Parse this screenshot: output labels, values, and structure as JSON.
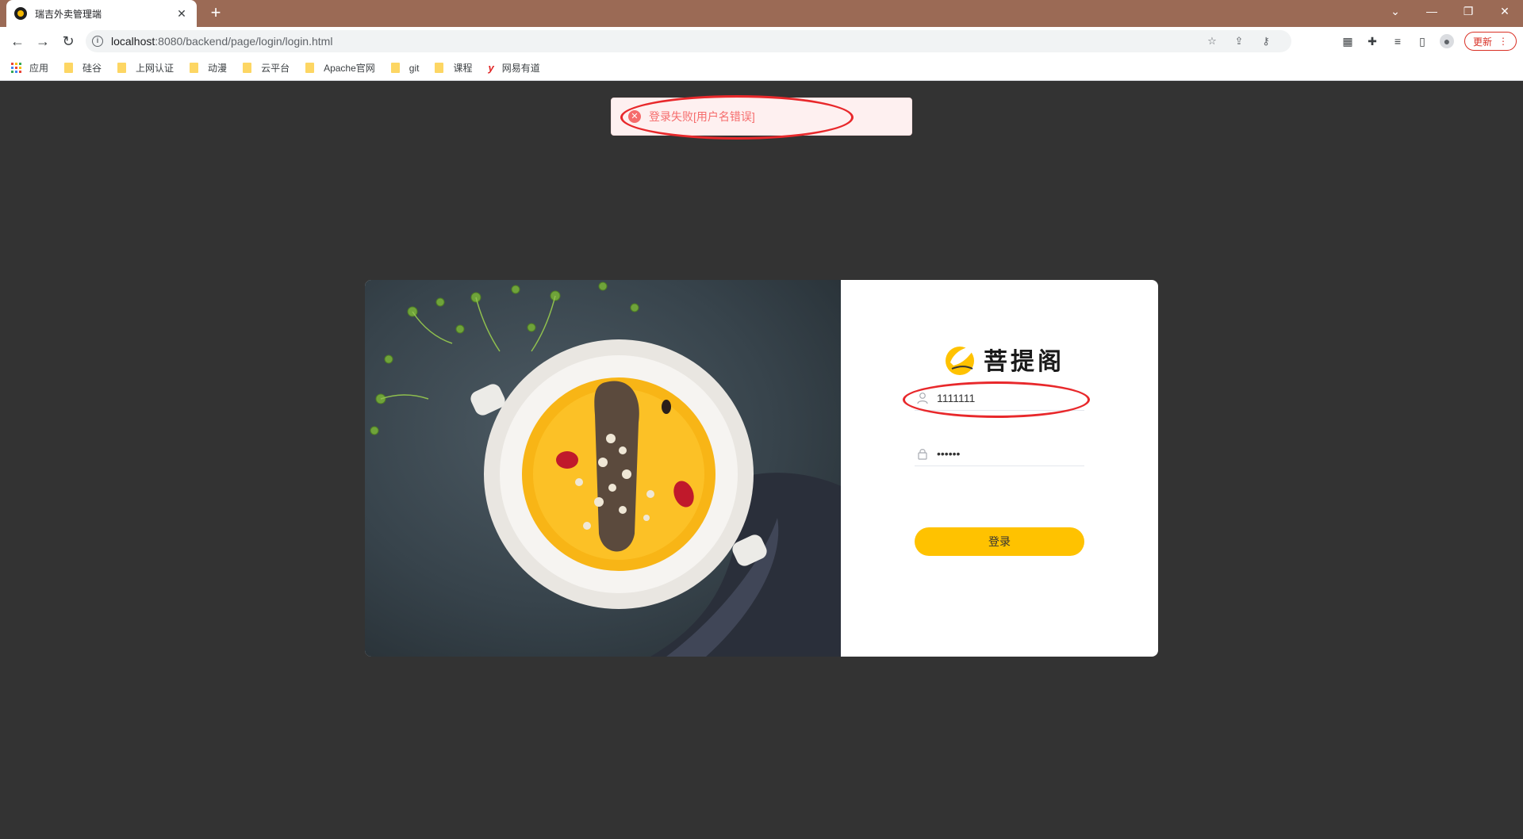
{
  "browser": {
    "tab_title": "瑞吉外卖管理端",
    "tab_close": "✕",
    "new_tab": "+",
    "url_host": "localhost",
    "url_path": ":8080/backend/page/login/login.html",
    "update_label": "更新"
  },
  "bookmarks": [
    {
      "label": "应用",
      "icon": "apps-icon"
    },
    {
      "label": "硅谷",
      "icon": "folder-icon"
    },
    {
      "label": "上网认证",
      "icon": "folder-icon"
    },
    {
      "label": "动漫",
      "icon": "folder-icon"
    },
    {
      "label": "云平台",
      "icon": "folder-icon"
    },
    {
      "label": "Apache官网",
      "icon": "folder-icon"
    },
    {
      "label": "git",
      "icon": "folder-icon"
    },
    {
      "label": "课程",
      "icon": "folder-icon"
    },
    {
      "label": "网易有道",
      "icon": "youdao-icon"
    }
  ],
  "message": {
    "text": "登录失败[用户名错误]",
    "type": "error"
  },
  "login": {
    "brand_name": "菩提阁",
    "username_value": "1111111",
    "password_value": "123456",
    "submit_label": "登录"
  },
  "colors": {
    "accent": "#ffc200",
    "error": "#f56c6c",
    "background": "#333333",
    "annotation": "#e8282b"
  }
}
